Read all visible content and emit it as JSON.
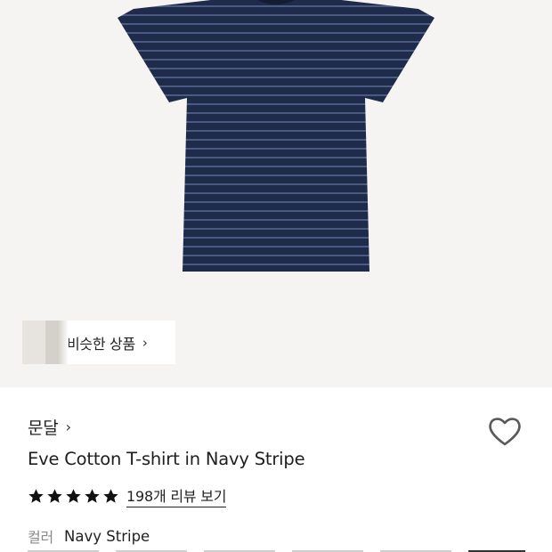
{
  "similar_products": {
    "label": "비슷한 상품"
  },
  "product": {
    "brand": "문달",
    "title": "Eve Cotton T-shirt in Navy Stripe",
    "rating": 5,
    "reviews_label": "198개 리뷰 보기",
    "color_label": "컬러",
    "color_value": "Navy Stripe"
  },
  "icons": {
    "brand_chevron": "chevron-right-icon",
    "similar_chevron": "chevron-right-icon",
    "wishlist": "heart-outline-icon",
    "star": "star-filled-icon"
  },
  "colors": {
    "hero_bg": "#f5f4f2",
    "shirt_navy": "#1f2b4b",
    "shirt_stripe": "#4a5a80",
    "text": "#1f1f1f",
    "muted": "#8a8a8a"
  }
}
